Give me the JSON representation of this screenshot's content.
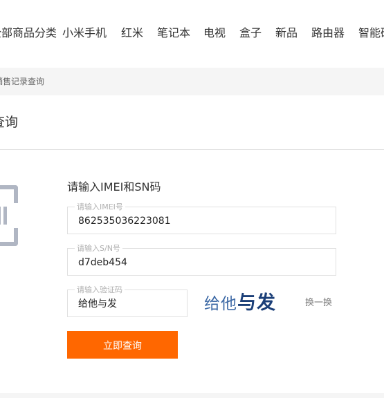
{
  "nav": {
    "items": [
      {
        "label": "全部商品分类"
      },
      {
        "label": "小米手机"
      },
      {
        "label": "红米"
      },
      {
        "label": "笔记本"
      },
      {
        "label": "电视"
      },
      {
        "label": "盒子"
      },
      {
        "label": "新品"
      },
      {
        "label": "路由器"
      },
      {
        "label": "智能硬件"
      }
    ]
  },
  "breadcrumb": {
    "text": "销售记录查询"
  },
  "page": {
    "title": "查询"
  },
  "icon": {
    "name": "scan-frame-icon",
    "color": "#b0b6c3"
  },
  "form": {
    "heading": "请输入IMEI和SN码",
    "imei": {
      "label": "请输入IMEI号",
      "value": "862535036223081"
    },
    "sn": {
      "label": "请输入S/N号",
      "value": "d7deb454"
    },
    "captcha": {
      "label": "请输入验证码",
      "value": "给他与发",
      "image_text_a": "给他",
      "image_text_b": "与发"
    },
    "refresh_label": "换一换",
    "submit_label": "立即查询"
  },
  "colors": {
    "accent": "#ff6700",
    "border": "#e0e0e0",
    "background_strip": "#f5f5f5"
  }
}
